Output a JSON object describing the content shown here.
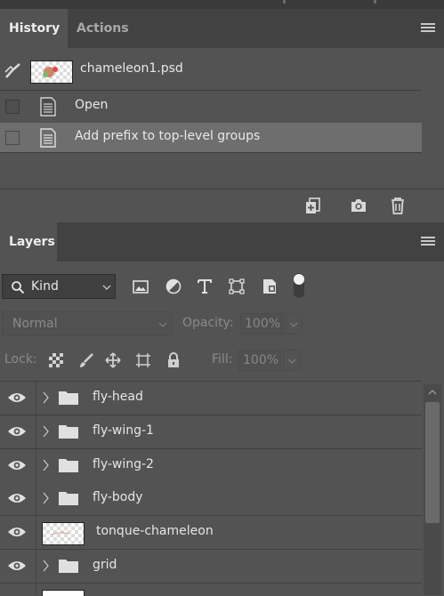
{
  "history_panel": {
    "tabs": [
      {
        "label": "History",
        "active": true
      },
      {
        "label": "Actions",
        "active": false
      }
    ],
    "snapshot": {
      "label": "chameleon1.psd"
    },
    "states": [
      {
        "label": "Open",
        "selected": false
      },
      {
        "label": "Add prefix to top-level groups",
        "selected": true
      }
    ],
    "footer_icons": [
      "new-document-from-state-icon",
      "camera-icon",
      "trash-icon"
    ]
  },
  "layers_panel": {
    "tab": {
      "label": "Layers"
    },
    "filter": {
      "kind_label": "Kind",
      "icons": [
        "image-filter-icon",
        "adjustment-filter-icon",
        "type-filter-icon",
        "shape-filter-icon",
        "smart-object-filter-icon",
        "filter-toggle-icon"
      ]
    },
    "blend_mode": "Normal",
    "opacity_label": "Opacity:",
    "opacity_value": "100%",
    "lock_label": "Lock:",
    "lock_icons": [
      "lock-transparent-pixels-icon",
      "lock-image-pixels-icon",
      "lock-position-icon",
      "lock-artboard-icon",
      "lock-all-icon"
    ],
    "fill_label": "Fill:",
    "fill_value": "100%",
    "layers": [
      {
        "name": "fly-head",
        "type": "group",
        "visible": true
      },
      {
        "name": "fly-wing-1",
        "type": "group",
        "visible": true
      },
      {
        "name": "fly-wing-2",
        "type": "group",
        "visible": true
      },
      {
        "name": "fly-body",
        "type": "group",
        "visible": true
      },
      {
        "name": "tonque-chameleon",
        "type": "layer",
        "visible": true
      },
      {
        "name": "grid",
        "type": "group",
        "visible": true
      }
    ]
  },
  "colors": {
    "panel_bg": "#535353",
    "tabbar_bg": "#424242",
    "selected_row": "#6e6e6e"
  }
}
